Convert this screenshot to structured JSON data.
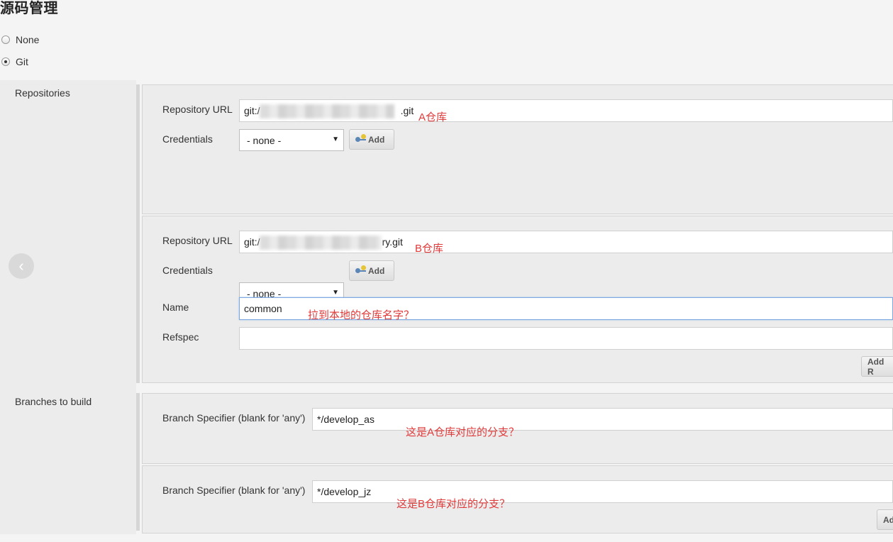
{
  "section_title": "源码管理",
  "scm_options": [
    {
      "label": "None",
      "selected": false
    },
    {
      "label": "Git",
      "selected": true
    }
  ],
  "repositories": {
    "label": "Repositories",
    "items": [
      {
        "url_label": "Repository URL",
        "url_prefix": "git:/",
        "url_suffix": ".git",
        "annotation": "A仓库",
        "credentials_label": "Credentials",
        "credentials_value": "- none -",
        "add_label": "Add"
      },
      {
        "url_label": "Repository URL",
        "url_prefix": "git:/",
        "url_suffix": "ry.git",
        "annotation": "B仓库",
        "credentials_label": "Credentials",
        "credentials_value": "- none -",
        "add_label": "Add",
        "name_label": "Name",
        "name_value": "common",
        "name_annotation": "拉到本地的仓库名字？",
        "refspec_label": "Refspec",
        "refspec_value": ""
      }
    ],
    "add_repository_label": "Add R"
  },
  "branches": {
    "label": "Branches to build",
    "items": [
      {
        "label": "Branch Specifier (blank for 'any')",
        "value": "*/develop_as",
        "annotation": "这是A仓库对应的分支？"
      },
      {
        "label": "Branch Specifier (blank for 'any')",
        "value": "*/develop_jz",
        "annotation": "这是B仓库对应的分支？"
      }
    ],
    "add_branch_label": "Ad"
  },
  "colors": {
    "annotation": "#e03a3a",
    "focus_border": "#7aa7dd"
  }
}
